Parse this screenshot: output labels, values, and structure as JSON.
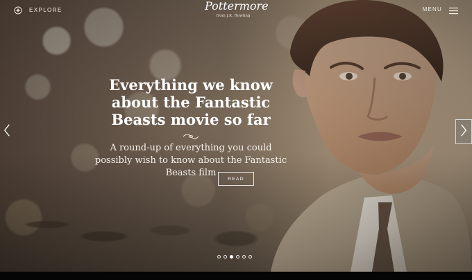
{
  "header": {
    "explore_label": "EXPLORE",
    "brand_logo": "Pottermore",
    "brand_sub": "from J.K. Rowling",
    "menu_label": "MENU"
  },
  "hero": {
    "title": "Everything we know about the Fantastic Beasts movie so far",
    "subtitle": "A round-up of everything you could possibly wish to know about the Fantastic Beasts film",
    "read_label": "READ"
  },
  "carousel": {
    "slide_count": 6,
    "active_index": 2
  },
  "icons": {
    "explore": "compass-icon",
    "menu": "hamburger-icon",
    "prev": "chevron-left-icon",
    "next": "chevron-right-icon",
    "flourish": "ornament-icon"
  }
}
